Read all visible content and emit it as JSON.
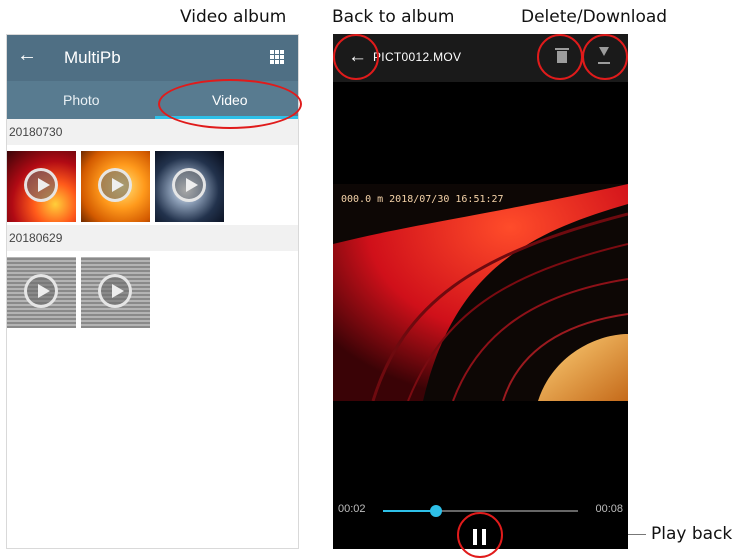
{
  "annotations": {
    "video_album": "Video album",
    "back_to_album": "Back to album",
    "delete_download": "Delete/Download",
    "play_back": "Play back"
  },
  "gallery": {
    "app_title": "MultiPb",
    "tabs": {
      "photo": "Photo",
      "video": "Video"
    },
    "active_tab": "Video",
    "groups": [
      {
        "date": "20180730",
        "item_count": 3
      },
      {
        "date": "20180629",
        "item_count": 2
      }
    ]
  },
  "player": {
    "file_name": "PICT0012.MOV",
    "osd_text": "000.0 m   2018/07/30 16:51:27",
    "time_current": "00:02",
    "time_total": "00:08",
    "progress_fraction": 0.27
  },
  "colors": {
    "accent": "#2ec0e8",
    "highlight": "#e01b1b",
    "toolbar": "#4f6f84"
  },
  "icons": [
    "back-arrow-icon",
    "grid-icon",
    "play-icon",
    "trash-icon",
    "download-icon",
    "pause-icon"
  ]
}
